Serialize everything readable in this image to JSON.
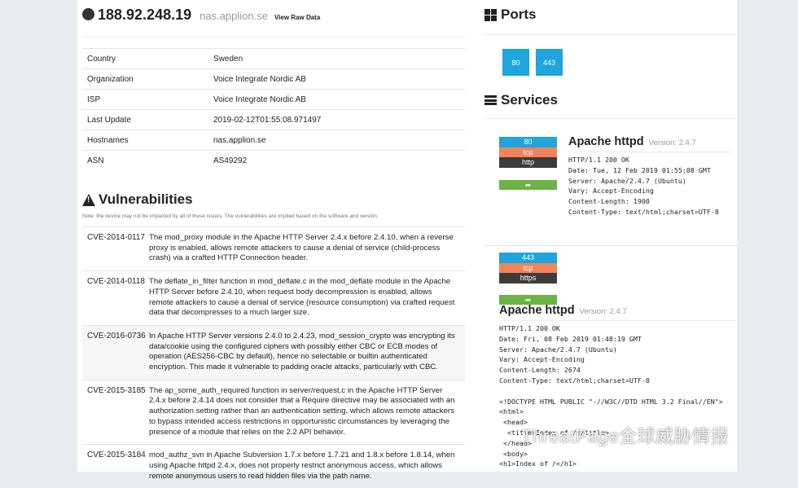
{
  "host": {
    "ip": "188.92.248.19",
    "hostname": "nas.applion.se",
    "raw_link": "View Raw Data",
    "icon": "globe-icon"
  },
  "info": [
    {
      "label": "Country",
      "value": "Sweden"
    },
    {
      "label": "Organization",
      "value": "Voice Integrate Nordic AB"
    },
    {
      "label": "ISP",
      "value": "Voice Integrate Nordic AB"
    },
    {
      "label": "Last Update",
      "value": "2019-02-12T01:55:08.971497"
    },
    {
      "label": "Hostnames",
      "value": "nas.applion.se"
    },
    {
      "label": "ASN",
      "value": "AS49292"
    }
  ],
  "vulns": {
    "title": "Vulnerabilities",
    "note": "Note: the device may not be impacted by all of these issues. The vulnerabilities are implied based on the software and version.",
    "items": [
      {
        "id": "CVE-2014-0117",
        "desc": "The mod_proxy module in the Apache HTTP Server 2.4.x before 2.4.10, when a reverse proxy is enabled, allows remote attackers to cause a denial of service (child-process crash) via a crafted HTTP Connection header."
      },
      {
        "id": "CVE-2014-0118",
        "desc": "The deflate_in_filter function in mod_deflate.c in the mod_deflate module in the Apache HTTP Server before 2.4.10, when request body decompression is enabled, allows remote attackers to cause a denial of service (resource consumption) via crafted request data that decompresses to a much larger size."
      },
      {
        "id": "CVE-2016-0736",
        "desc": "In Apache HTTP Server versions 2.4.0 to 2.4.23, mod_session_crypto was encrypting its data/cookie using the configured ciphers with possibly either CBC or ECB modes of operation (AES256-CBC by default), hence no selectable or builtin authenticated encryption. This made it vulnerable to padding oracle attacks, particularly with CBC."
      },
      {
        "id": "CVE-2015-3185",
        "desc": "The ap_some_auth_required function in server/request.c in the Apache HTTP Server 2.4.x before 2.4.14 does not consider that a Require directive may be associated with an authorization setting rather than an authentication setting, which allows remote attackers to bypass intended access restrictions in opportunistic circumstances by leveraging the presence of a module that relies on the 2.2 API behavior."
      },
      {
        "id": "CVE-2015-3184",
        "desc": "mod_authz_svn in Apache Subversion 1.7.x before 1.7.21 and 1.8.x before 1.8.14, when using Apache httpd 2.4.x, does not properly restrict anonymous access, which allows remote anonymous users to read hidden files via the path name."
      }
    ]
  },
  "ports": {
    "title": "Ports",
    "items": [
      "80",
      "443"
    ],
    "color": "#1fa4dc"
  },
  "services": {
    "title": "Services",
    "items": [
      {
        "port": "80",
        "transport": "tcp",
        "protocol": "http",
        "share_icon": "share-icon",
        "product": "Apache httpd",
        "version": "Version: 2.4.7",
        "banner": "HTTP/1.1 200 OK\nDate: Tue, 12 Feb 2019 01:55:08 GMT\nServer: Apache/2.4.7 (Ubuntu)\nVary: Accept-Encoding\nContent-Length: 1900\nContent-Type: text/html;charset=UTF-8"
      },
      {
        "port": "443",
        "transport": "tcp",
        "protocol": "https",
        "share_icon": "share-icon",
        "product": "Apache httpd",
        "version": "Version: 2.4.7",
        "banner": "HTTP/1.1 200 OK\nDate: Fri, 08 Feb 2019 01:48:19 GMT\nServer: Apache/2.4.7 (Ubuntu)\nVary: Accept-Encoding\nContent-Length: 2674\nContent-Type: text/html;charset=UTF-8\n\n<!DOCTYPE HTML PUBLIC \"-//W3C//DTD HTML 3.2 Final//EN\">\n<html>\n <head>\n  <title>Index of /</title>\n </head>\n <body>\n<h1>Index of /</h1>"
      }
    ]
  },
  "watermark": "ThreatPage全球威胁情报"
}
